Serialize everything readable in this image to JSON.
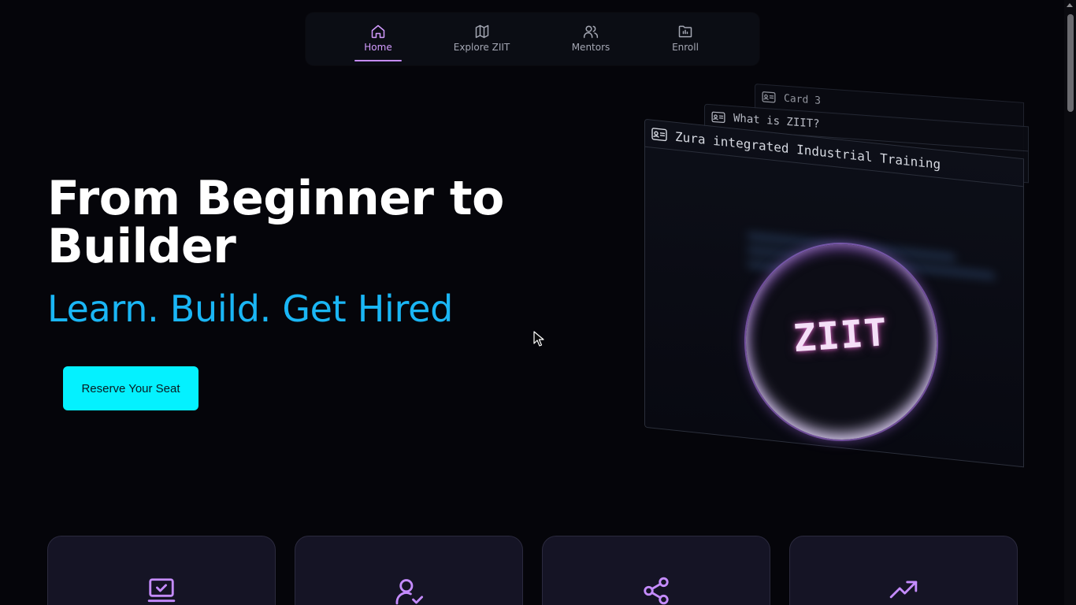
{
  "nav": {
    "items": [
      {
        "label": "Home",
        "icon": "home-icon",
        "active": true
      },
      {
        "label": "Explore ZIIT",
        "icon": "map-icon",
        "active": false
      },
      {
        "label": "Mentors",
        "icon": "users-icon",
        "active": false
      },
      {
        "label": "Enroll",
        "icon": "folder-chart-icon",
        "active": false
      }
    ]
  },
  "hero": {
    "title": "From Beginner to Builder",
    "subtitle": "Learn. Build. Get Hired",
    "cta_label": "Reserve Your Seat"
  },
  "cards": {
    "card3_title": "Card 3",
    "card2_title": "What is ZIIT?",
    "card1_title": "Zura integrated Industrial Training",
    "orb_label": "ZIIT"
  },
  "features": [
    {
      "icon": "laptop-check-icon"
    },
    {
      "icon": "user-check-icon"
    },
    {
      "icon": "share-icon"
    },
    {
      "icon": "trending-up-icon"
    }
  ],
  "colors": {
    "background": "#05050a",
    "accent_purple": "#c58cff",
    "accent_cyan": "#04f1ff",
    "subtitle_blue": "#1ab6f5"
  }
}
